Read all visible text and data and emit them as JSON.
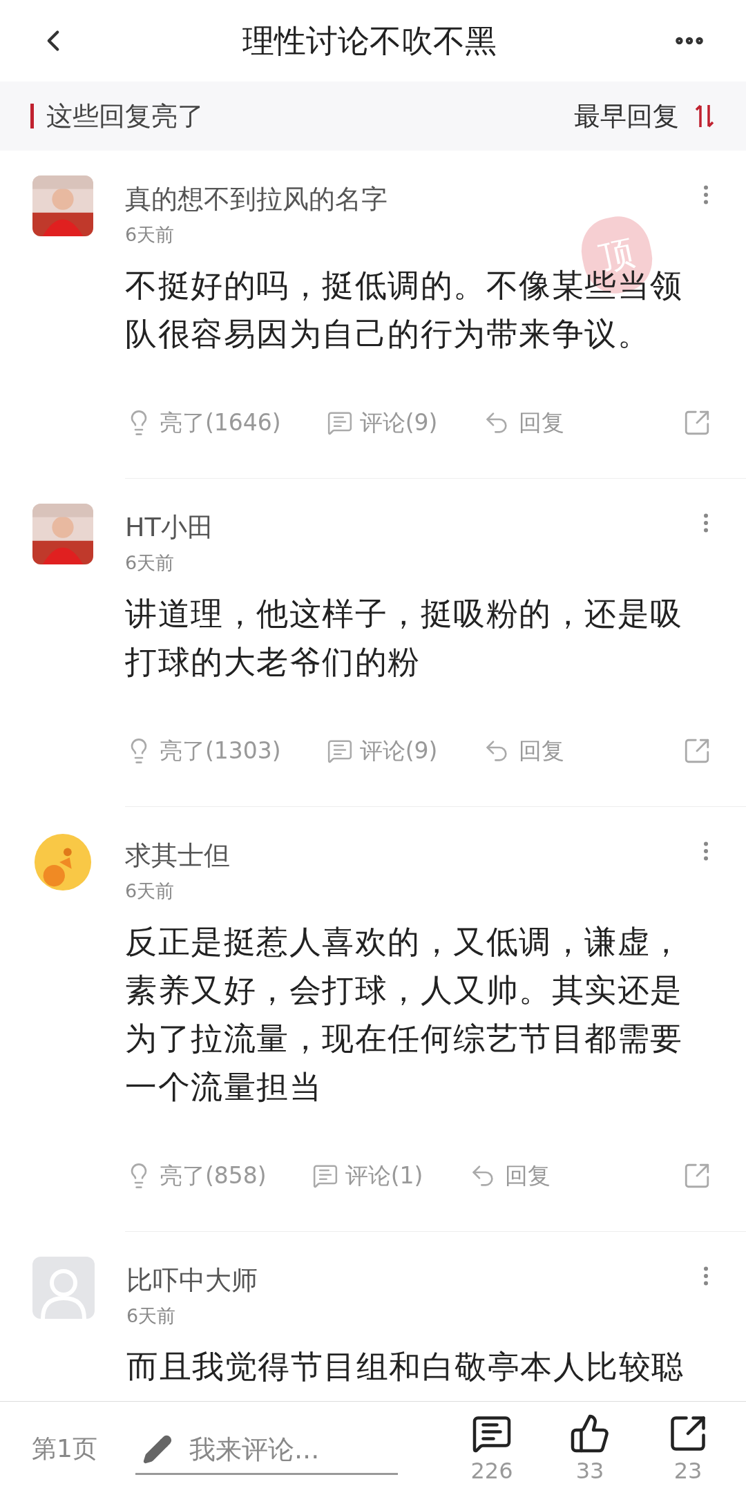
{
  "header": {
    "title": "理性讨论不吹不黑"
  },
  "section": {
    "title": "这些回复亮了",
    "sort": "最早回复"
  },
  "comments": [
    {
      "name": "真的想不到拉风的名字",
      "time": "6天前",
      "badge": "顶",
      "body": "不挺好的吗，挺低调的。不像某些当领队很容易因为自己的行为带来争议。",
      "light": "亮了(1646)",
      "comment": "评论(9)",
      "reply": "回复"
    },
    {
      "name": "HT小田",
      "time": "6天前",
      "body": "讲道理，他这样子，挺吸粉的，还是吸打球的大老爷们的粉",
      "light": "亮了(1303)",
      "comment": "评论(9)",
      "reply": "回复"
    },
    {
      "avatar": {
        "kind": "emoji"
      },
      "name": "求其士但",
      "time": "6天前",
      "body": "反正是挺惹人喜欢的，又低调，谦虚，素养又好，会打球，人又帅。其实还是为了拉流量，现在任何综艺节目都需要一个流量担当",
      "light": "亮了(858)",
      "comment": "评论(1)",
      "reply": "回复"
    },
    {
      "avatar": {
        "kind": "default"
      },
      "name": "比吓中大师",
      "time": "6天前",
      "body": "而且我觉得节目组和白敬亭本人比较聪"
    }
  ],
  "footer": {
    "page": "第1页",
    "placeholder": "我来评论...",
    "comments": "226",
    "likes": "33",
    "shares": "23"
  }
}
